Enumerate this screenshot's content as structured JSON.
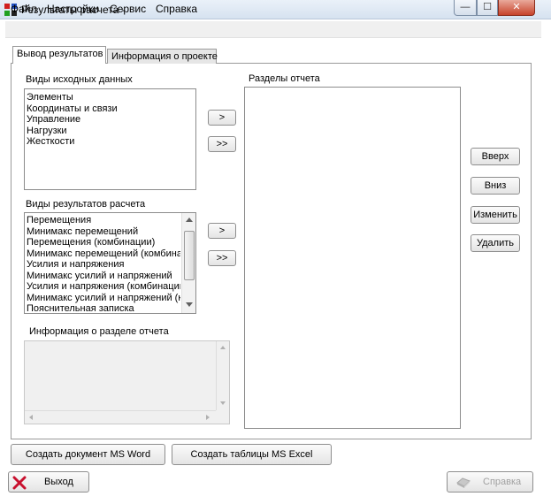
{
  "window": {
    "title": "Результаты расчета -",
    "min_glyph": "—",
    "max_glyph": "☐",
    "close_glyph": "✕"
  },
  "menu": [
    "Файл",
    "Настройки",
    "Сервис",
    "Справка"
  ],
  "tabs": {
    "results": "Вывод результатов",
    "project": "Информация о проекте"
  },
  "source_group": {
    "label": "Виды исходных данных",
    "items": [
      "Элементы",
      "Координаты и связи",
      "Управление",
      "Нагрузки",
      "Жесткости"
    ]
  },
  "results_group": {
    "label": "Виды результатов расчета",
    "items": [
      "Перемещения",
      "Минимакс перемещений",
      "Перемещения (комбинации)",
      "Минимакс перемещений (комбинации)",
      "Усилия и напряжения",
      "Минимакс усилий и напряжений",
      "Усилия и напряжения (комбинации)",
      "Минимакс усилий и напряжений (комбинации)",
      "Пояснительная записка"
    ]
  },
  "transfer": {
    "add_one": ">",
    "add_all": ">>"
  },
  "report_sections": {
    "label": "Разделы отчета"
  },
  "section_info": {
    "label": "Информация о разделе отчета"
  },
  "side_buttons": {
    "up": "Вверх",
    "down": "Вниз",
    "edit": "Изменить",
    "delete": "Удалить"
  },
  "bottom_buttons": {
    "word": "Создать документ MS Word",
    "excel": "Создать таблицы MS Excel",
    "exit": "Выход",
    "help": "Справка"
  },
  "colors": {
    "disabled_text": "#a0a0a0",
    "exit_icon": "#c8102e"
  }
}
